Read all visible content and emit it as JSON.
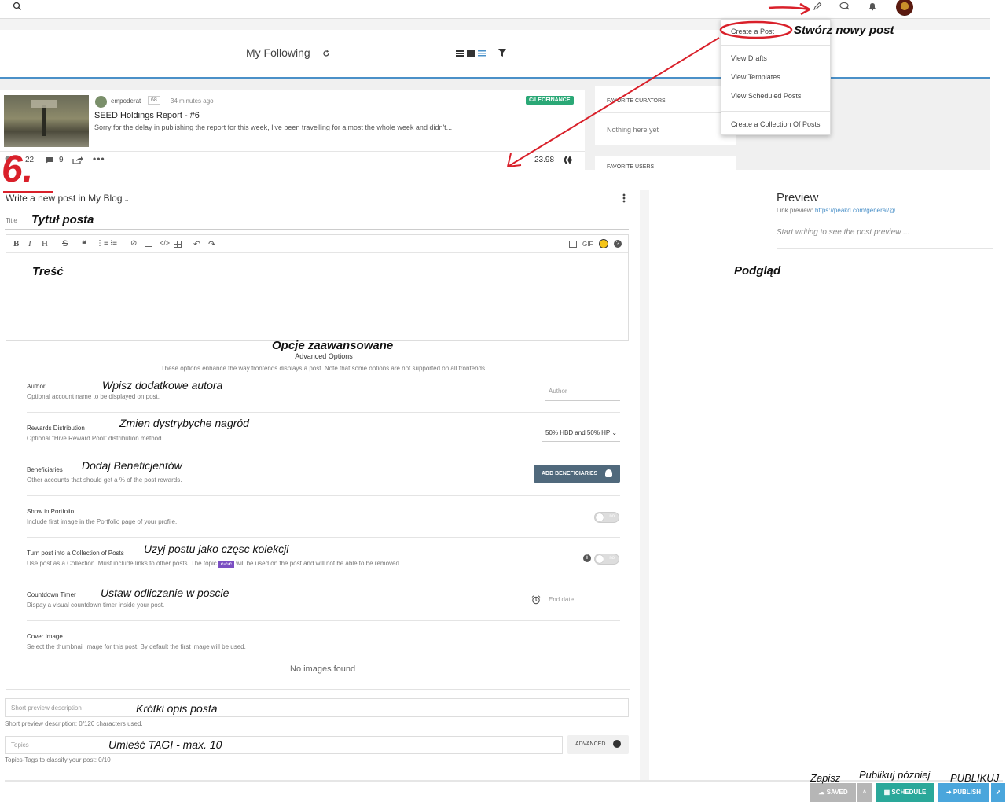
{
  "header": {
    "feed_title": "My Following"
  },
  "dropdown": {
    "items": [
      "Create a Post",
      "View Drafts",
      "View Templates",
      "View Scheduled Posts",
      "Create a Collection Of Posts"
    ]
  },
  "feed_post": {
    "author": "empoderat",
    "reputation": "68",
    "time": "· 34 minutes ago",
    "community": "C/LEOFINANCE",
    "title": "SEED Holdings Report - #6",
    "excerpt": "Sorry for the delay in publishing the report for this week, I've been travelling for almost the whole week and didn't...",
    "votes": "22",
    "comments": "9",
    "payout": "23.98"
  },
  "sidebar": {
    "favorite_curators_title": "FAVORITE CURATORS",
    "favorite_curators_empty": "Nothing here yet",
    "favorite_users_title": "FAVORITE USERS"
  },
  "editor": {
    "write_prefix": "Write a new post in",
    "blog_name": "My Blog",
    "title_label": "Title",
    "toolbar_gif": "GIF"
  },
  "advanced": {
    "heading": "Advanced Options",
    "intro": "These options enhance the way frontends displays a post. Note that some options are not supported on all frontends.",
    "author_label": "Author",
    "author_desc": "Optional account name to be displayed on post.",
    "author_placeholder": "Author",
    "rewards_label": "Rewards Distribution",
    "rewards_desc": "Optional \"Hive Reward Pool\" distribution method.",
    "rewards_value": "50% HBD and 50% HP",
    "beneficiaries_label": "Beneficiaries",
    "beneficiaries_desc": "Other accounts that should get a % of the post rewards.",
    "beneficiaries_button": "ADD BENEFICIARIES",
    "portfolio_label": "Show in Portfolio",
    "portfolio_desc": "Include first image in the Portfolio page of your profile.",
    "toggle_text": "no",
    "collection_label": "Turn post into a Collection of Posts",
    "collection_desc_1": "Use post as a Collection. Must include links to other posts. The topic",
    "collection_badge": "c-c-c",
    "collection_desc_2": "will be used on the post and will not be able to be removed",
    "countdown_label": "Countdown Timer",
    "countdown_desc": "Dispay a visual countdown timer inside your post.",
    "countdown_placeholder": "End date",
    "cover_label": "Cover Image",
    "cover_desc": "Select the thumbnail image for this post. By default the first image will be used.",
    "no_images": "No images found"
  },
  "short_preview": {
    "placeholder": "Short preview description",
    "counter": "Short preview description: 0/120 characters used."
  },
  "topics": {
    "placeholder": "Topics",
    "counter": "Topics-Tags to classify your post: 0/10",
    "advanced_button": "ADVANCED"
  },
  "preview": {
    "title": "Preview",
    "link_label": "Link preview:",
    "link_url": "https://peakd.com/general/@",
    "placeholder": "Start writing to see the post preview ..."
  },
  "bottom": {
    "saved": "SAVED",
    "schedule": "SCHEDULE",
    "publish": "PUBLISH"
  },
  "annotations": {
    "step": "6.",
    "create_post": "Stwórz nowy post",
    "title": "Tytuł posta",
    "content": "Treść",
    "preview": "Podgląd",
    "advanced": "Opcje zaawansowane",
    "author": "Wpisz dodatkowe autora",
    "rewards": "Zmien dystrybyche nagród",
    "beneficiaries": "Dodaj Beneficjentów",
    "collection": "Uzyj postu jako częsc kolekcji",
    "countdown": "Ustaw odliczanie w poscie",
    "short_desc": "Krótki opis posta",
    "tags": "Umieść TAGI - max. 10",
    "save": "Zapisz",
    "schedule": "Publikuj pózniej",
    "publish": "PUBLIKUJ"
  },
  "colors": {
    "accent_green": "#2aa876",
    "primary_blue": "#4a90c8",
    "annotation_red": "#d9202a",
    "button_slate": "#50697c",
    "collection_purple": "#7b4fc2"
  }
}
